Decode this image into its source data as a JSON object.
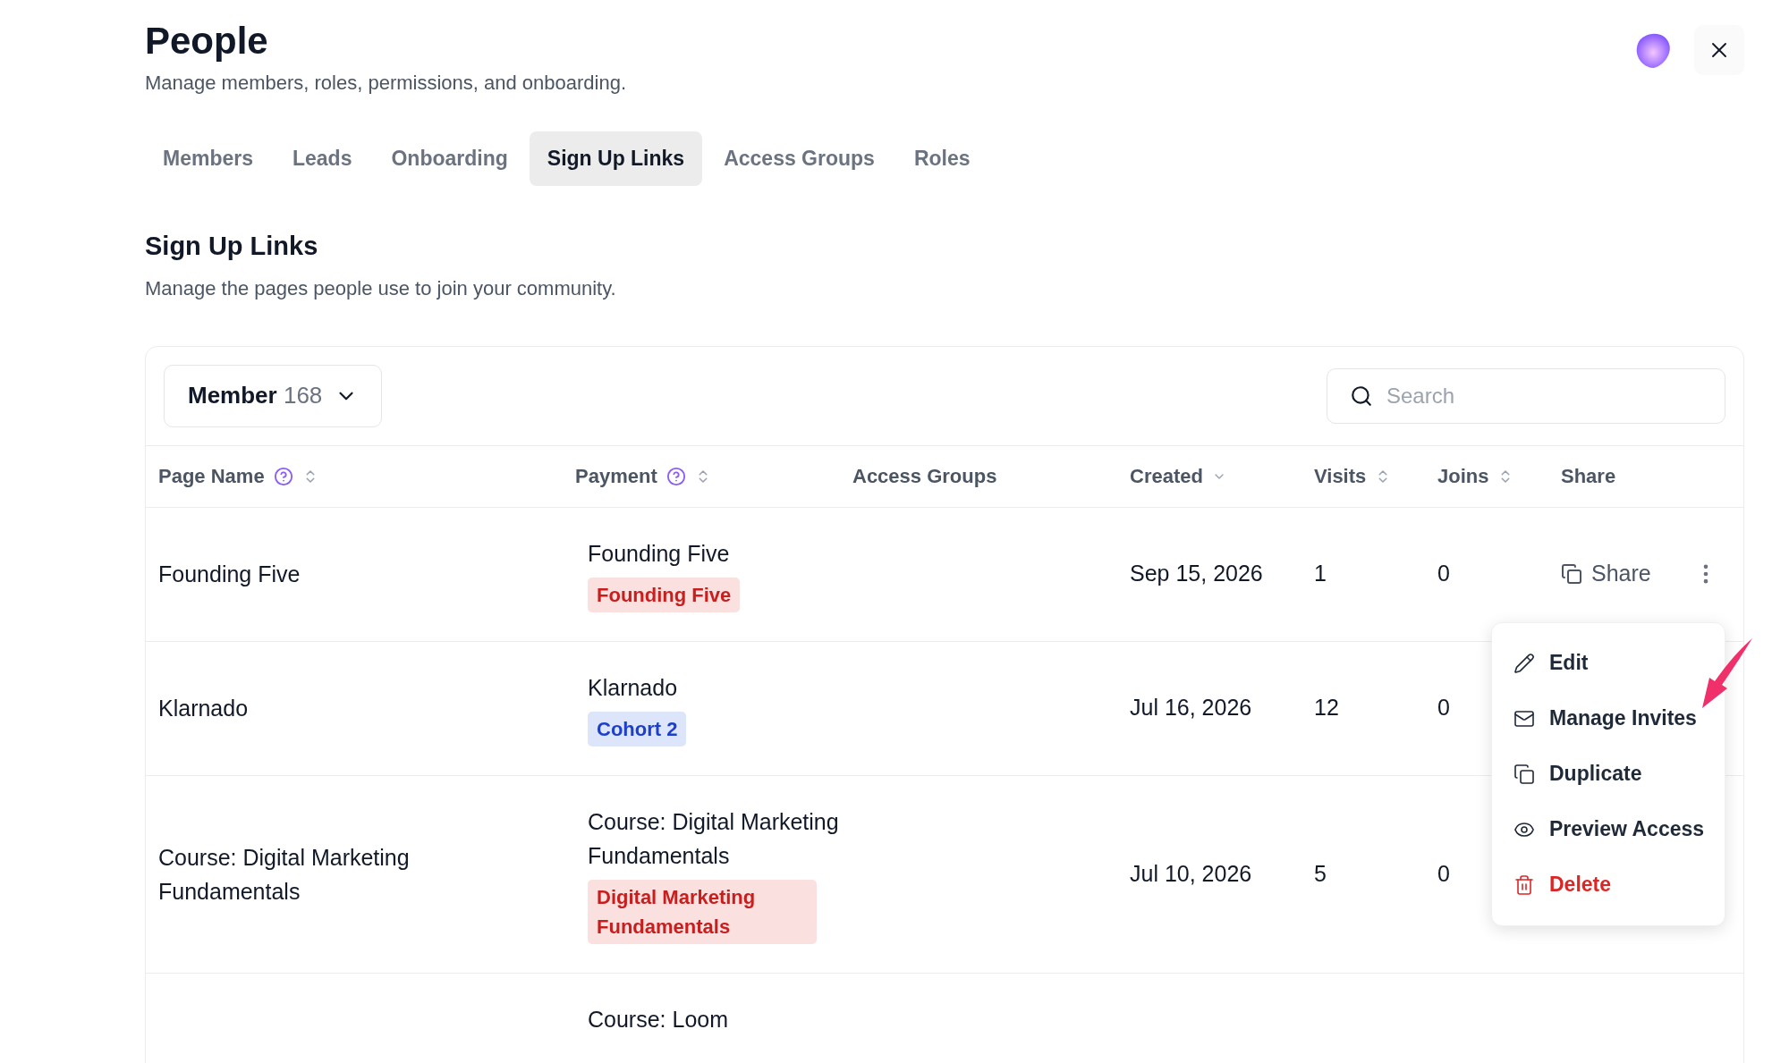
{
  "header": {
    "title": "People",
    "subtitle": "Manage members, roles, permissions, and onboarding."
  },
  "tabs": [
    {
      "label": "Members",
      "selected": false
    },
    {
      "label": "Leads",
      "selected": false
    },
    {
      "label": "Onboarding",
      "selected": false
    },
    {
      "label": "Sign Up Links",
      "selected": true
    },
    {
      "label": "Access Groups",
      "selected": false
    },
    {
      "label": "Roles",
      "selected": false
    }
  ],
  "section": {
    "title": "Sign Up Links",
    "description": "Manage the pages people use to join your community."
  },
  "filter": {
    "label": "Member",
    "count": "168"
  },
  "search": {
    "placeholder": "Search"
  },
  "table": {
    "columns": [
      {
        "label": "Page Name",
        "kind": "helpsort"
      },
      {
        "label": "Payment",
        "kind": "helpsort"
      },
      {
        "label": "Access Groups",
        "kind": "plain"
      },
      {
        "label": "Created",
        "kind": "descending"
      },
      {
        "label": "Visits",
        "kind": "sortable"
      },
      {
        "label": "Joins",
        "kind": "sortable"
      },
      {
        "label": "Share",
        "kind": "plain"
      }
    ],
    "rows": [
      {
        "page_name": "Founding Five",
        "payment": "Founding Five",
        "tag": {
          "label": "Founding Five",
          "color": "#c81e1e"
        },
        "created": "Sep 15, 2026",
        "visits": "1",
        "joins": "0",
        "share": "Share"
      },
      {
        "page_name": "Klarnado",
        "payment": "Klarnado",
        "tag": {
          "label": "Cohort 2",
          "color": "#1e40c8"
        },
        "created": "Jul 16, 2026",
        "visits": "12",
        "joins": "0"
      },
      {
        "page_name": "Course: Digital Marketing Fundamentals",
        "payment": "Course: Digital Marketing Fundamentals",
        "tag": {
          "label": "Digital Marketing Fundamentals",
          "color": "#c81e1e"
        },
        "created": "Jul 10, 2026",
        "visits": "5",
        "joins": "0"
      },
      {
        "payment": "Course: Loom"
      }
    ]
  },
  "menu": {
    "items": [
      {
        "label": "Edit",
        "kind": "edit"
      },
      {
        "label": "Manage Invites",
        "kind": "invite"
      },
      {
        "label": "Duplicate",
        "kind": "duplicate"
      },
      {
        "label": "Preview Access",
        "kind": "preview"
      },
      {
        "label": "Delete",
        "kind": "delete"
      }
    ]
  }
}
